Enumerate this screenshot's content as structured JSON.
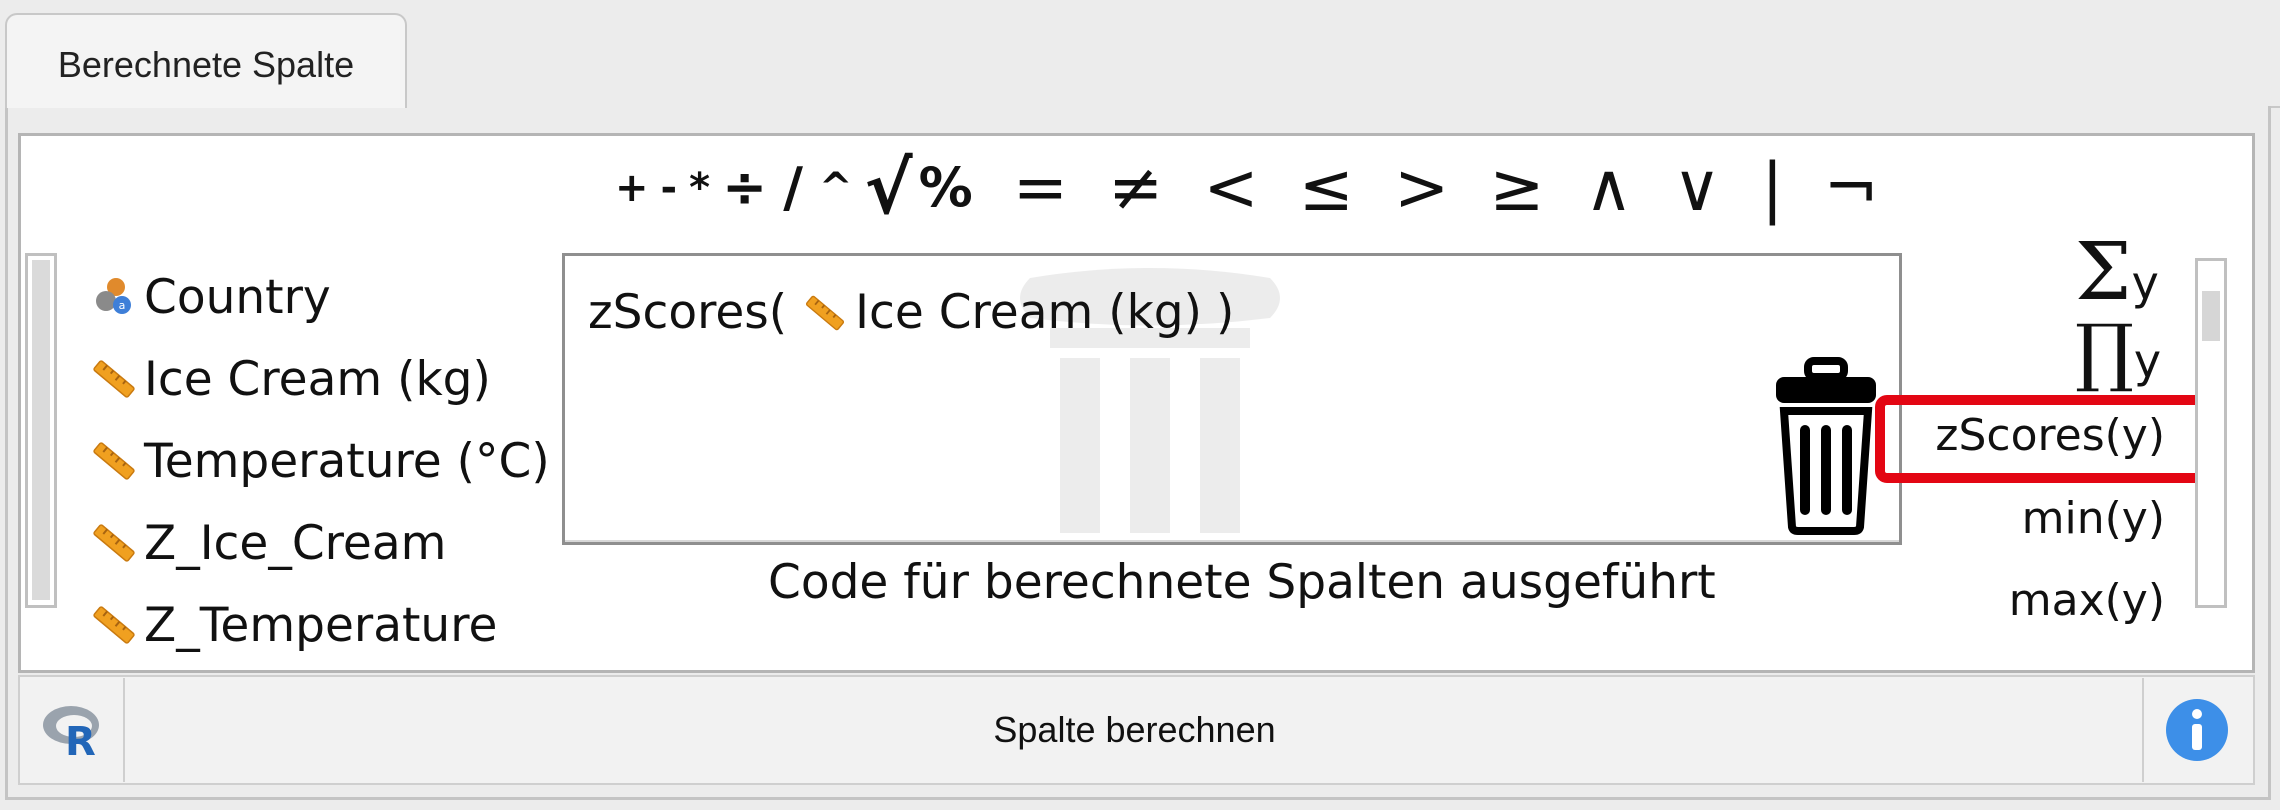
{
  "tab": {
    "label": "Berechnete Spalte"
  },
  "operators": [
    "+",
    "-",
    "*",
    "÷",
    "/",
    "^",
    "√",
    "%",
    "=",
    "≠",
    "<",
    "≤",
    ">",
    "≥",
    "∧",
    "∨",
    "|",
    "¬"
  ],
  "variables": [
    {
      "name": "Country",
      "type": "nominal-text-icon"
    },
    {
      "name": "Ice Cream (kg)",
      "type": "scale-ruler-icon"
    },
    {
      "name": "Temperature (°C)",
      "type": "scale-ruler-icon"
    },
    {
      "name": "Z_Ice_Cream",
      "type": "scale-ruler-icon"
    },
    {
      "name": "Z_Temperature",
      "type": "scale-ruler-icon"
    }
  ],
  "formula": {
    "function_open": "zScores(",
    "argument": "Ice Cream (kg)",
    "close": ")"
  },
  "status_text": "Code für berechnete Spalten ausgeführt",
  "functions": {
    "sum": {
      "symbol": "Σ",
      "arg": "y"
    },
    "prod": {
      "symbol": "∏",
      "arg": "y"
    },
    "zscores": "zScores(y)",
    "min": "min(y)",
    "max": "max(y)"
  },
  "bottom_bar": {
    "compute_label": "Spalte berechnen",
    "r_icon": "r-logo-icon",
    "info_icon": "info-icon"
  },
  "colors": {
    "highlight": "#e30613",
    "ruler": "#f0a020",
    "info": "#3d8fe8"
  }
}
